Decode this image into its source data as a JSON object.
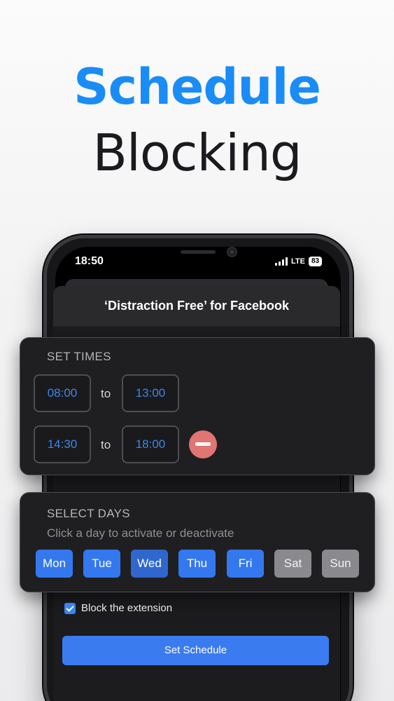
{
  "headline": {
    "line1": "Schedule",
    "line2": "Blocking"
  },
  "status_bar": {
    "time": "18:50",
    "network": "LTE",
    "battery": "83"
  },
  "app": {
    "title": "‘Distraction Free’ for Facebook"
  },
  "set_times": {
    "title": "SET TIMES",
    "to_label": "to",
    "ranges": [
      {
        "start": "08:00",
        "end": "13:00"
      },
      {
        "start": "14:30",
        "end": "18:00"
      }
    ]
  },
  "select_days": {
    "title": "SELECT DAYS",
    "subtitle": "Click a day to activate or deactivate",
    "days": [
      {
        "label": "Mon",
        "active": true
      },
      {
        "label": "Tue",
        "active": true
      },
      {
        "label": "Wed",
        "active": true
      },
      {
        "label": "Thu",
        "active": true
      },
      {
        "label": "Fri",
        "active": true
      },
      {
        "label": "Sat",
        "active": false
      },
      {
        "label": "Sun",
        "active": false
      }
    ]
  },
  "options": {
    "block_extension_label": "Block the extension",
    "block_extension_checked": true
  },
  "actions": {
    "set_schedule_label": "Set Schedule"
  },
  "colors": {
    "accent": "#1a8cf5",
    "button": "#3b7bf0",
    "remove": "#e07572"
  }
}
